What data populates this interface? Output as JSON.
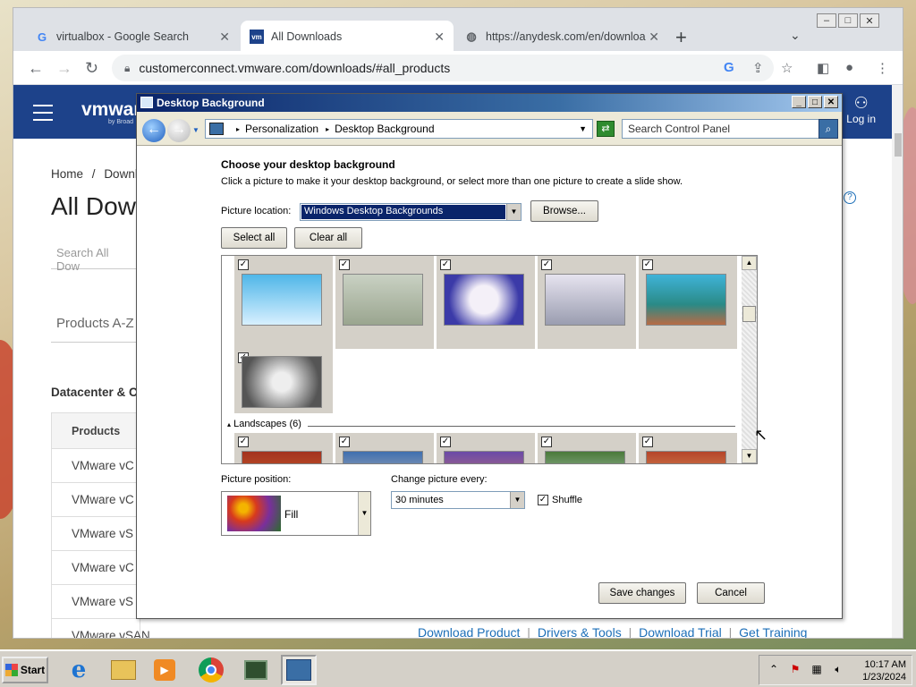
{
  "browser": {
    "tabs": [
      {
        "label": "virtualbox - Google Search",
        "icon": "google-icon"
      },
      {
        "label": "All Downloads",
        "icon": "vmware-icon"
      },
      {
        "label": "https://anydesk.com/en/downloa",
        "icon": "globe-icon"
      }
    ],
    "url": "customerconnect.vmware.com/downloads/#all_products"
  },
  "vmware": {
    "logo": "vmware",
    "logo_sub": "by Broad",
    "login": "Log in",
    "breadcrumb_home": "Home",
    "breadcrumb_sep": "/",
    "breadcrumb_next": "Downl",
    "title": "All Dow",
    "search_placeholder": "Search All Dow",
    "products_az": "Products A-Z",
    "section_heading": "Datacenter & C",
    "table_header": "Products",
    "rows": [
      "VMware vC",
      "VMware vC",
      "VMware vS",
      "VMware vC",
      "VMware vS",
      "VMware vSAN"
    ],
    "bottom_links": [
      "Download Product",
      "Drivers & Tools",
      "Download Trial",
      "Get Training"
    ]
  },
  "dialog": {
    "title": "Desktop Background",
    "breadcrumb": [
      "Personalization",
      "Desktop Background"
    ],
    "search_placeholder": "Search Control Panel",
    "heading": "Choose your desktop background",
    "subheading": "Click a picture to make it your desktop background, or select more than one picture to create a slide show.",
    "picture_location_label": "Picture location:",
    "picture_location_value": "Windows Desktop Backgrounds",
    "browse_label": "Browse...",
    "select_all_label": "Select all",
    "clear_all_label": "Clear all",
    "group_label": "Landscapes (6)",
    "picture_position_label": "Picture position:",
    "picture_position_value": "Fill",
    "change_every_label": "Change picture every:",
    "change_every_value": "30 minutes",
    "shuffle_label": "Shuffle",
    "shuffle_checked": true,
    "save_label": "Save changes",
    "cancel_label": "Cancel"
  },
  "taskbar": {
    "start_label": "Start",
    "time": "10:17 AM",
    "date": "1/23/2024"
  },
  "colors": {
    "vmware_header": "#1d428a",
    "dialog_title": "#0a246a",
    "link": "#1d6fb8"
  }
}
